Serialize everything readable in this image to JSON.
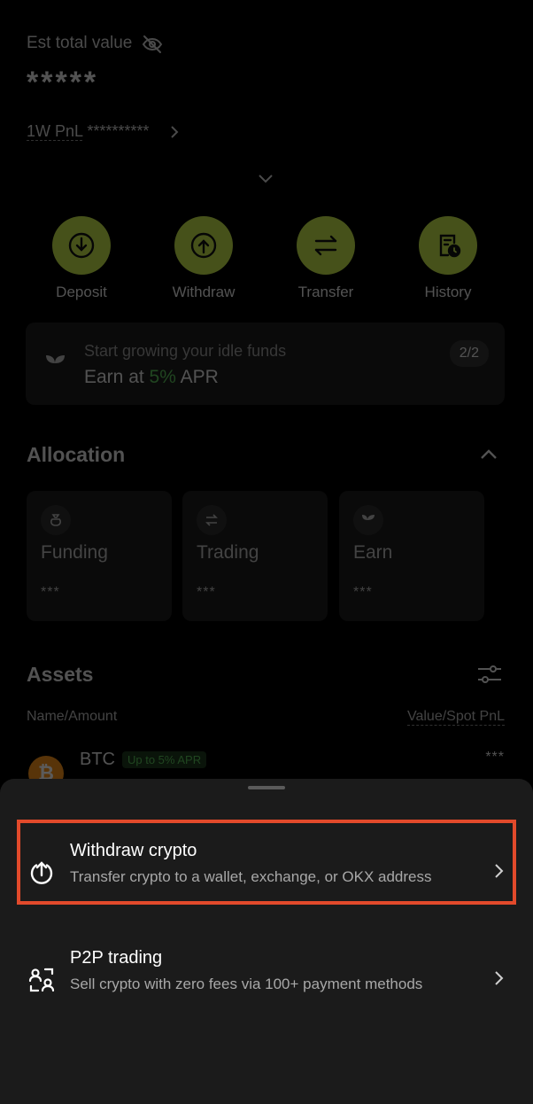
{
  "header": {
    "est_total_label": "Est total value",
    "masked_value": "*****",
    "pnl_label": "1W PnL",
    "pnl_value": "**********"
  },
  "actions": [
    {
      "label": "Deposit",
      "icon": "deposit-icon"
    },
    {
      "label": "Withdraw",
      "icon": "withdraw-icon"
    },
    {
      "label": "Transfer",
      "icon": "transfer-icon"
    },
    {
      "label": "History",
      "icon": "history-icon"
    }
  ],
  "promo": {
    "line1": "Start growing your idle funds",
    "line2_prefix": "Earn at ",
    "line2_accent": "5%",
    "line2_suffix": " APR",
    "badge": "2/2"
  },
  "allocation": {
    "title": "Allocation",
    "cards": [
      {
        "name": "Funding",
        "value": "***"
      },
      {
        "name": "Trading",
        "value": "***"
      },
      {
        "name": "Earn",
        "value": "***"
      }
    ]
  },
  "assets": {
    "title": "Assets",
    "col_left": "Name/Amount",
    "col_right": "Value/Spot PnL",
    "rows": [
      {
        "name": "BTC",
        "badge": "Up to 5% APR",
        "value": "***"
      }
    ]
  },
  "sheet": {
    "options": [
      {
        "title": "Withdraw crypto",
        "desc": "Transfer crypto to a wallet, exchange, or OKX address"
      },
      {
        "title": "P2P trading",
        "desc": "Sell crypto with zero fees via 100+ payment methods"
      }
    ]
  },
  "colors": {
    "accent_lime": "#c3e44a",
    "apr_green": "#5ac05a",
    "highlight": "#e24a2b"
  }
}
